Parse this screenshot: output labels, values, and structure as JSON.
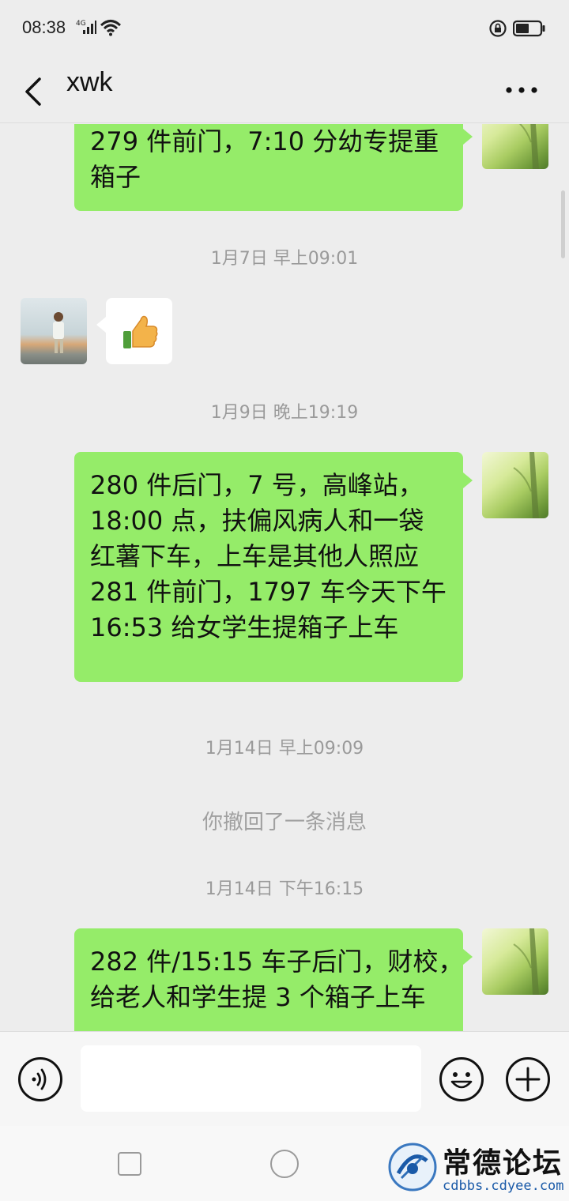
{
  "status_bar": {
    "time": "08:38",
    "network": "4G"
  },
  "header": {
    "title": "xwk",
    "back_icon": "chevron-left-icon",
    "more_icon": "more-dots-icon"
  },
  "messages": [
    {
      "type": "sent",
      "lines": [
        "279 件前门，7:10 分幼专提重",
        "箱子"
      ]
    },
    {
      "type": "time",
      "text": "1月7日 早上09:01"
    },
    {
      "type": "received",
      "content_icon": "thumbs-up-icon"
    },
    {
      "type": "time",
      "text": "1月9日 晚上19:19"
    },
    {
      "type": "sent",
      "lines": [
        "280 件后门，7 号，高峰站，",
        "18:00 点，扶偏风病人和一袋",
        "红薯下车，上车是其他人照应",
        "281 件前门，1797 车今天下午",
        "16:53 给女学生提箱子上车"
      ]
    },
    {
      "type": "time",
      "text": "1月14日 早上09:09"
    },
    {
      "type": "system",
      "text": "你撤回了一条消息"
    },
    {
      "type": "time",
      "text": "1月14日 下午16:15"
    },
    {
      "type": "sent",
      "lines": [
        "282 件/15:15 车子后门，财校，",
        "给老人和学生提 3 个箱子上车"
      ]
    }
  ],
  "input_bar": {
    "voice_icon": "voice-icon",
    "input_value": "",
    "emoji_icon": "emoji-icon",
    "plus_icon": "plus-icon"
  },
  "nav_bar": {
    "recents_icon": "square-icon",
    "home_icon": "circle-icon"
  },
  "watermark": {
    "title": "常德论坛",
    "url": "cdbbs.cdyee.com"
  },
  "colors": {
    "sent_bubble": "#95ec69",
    "background": "#ededed"
  }
}
